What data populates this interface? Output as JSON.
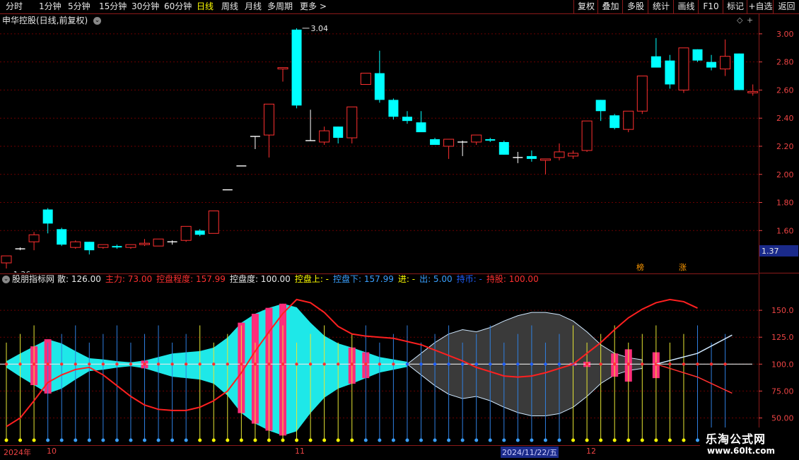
{
  "toolbar": {
    "periods": [
      "分时",
      "1分钟",
      "5分钟",
      "15分钟",
      "30分钟",
      "60分钟",
      "日线",
      "周线",
      "月线",
      "多周期",
      "更多 >"
    ],
    "active_period": "日线",
    "right_buttons": [
      "复权",
      "叠加",
      "多股",
      "统计",
      "画线",
      "F10",
      "标记",
      "+自选",
      "返回"
    ]
  },
  "main": {
    "title": "申华控股(日线,前复权)",
    "high_label": "3.04",
    "low_label": "1.36",
    "price_tag": "1.37",
    "tag_bang": "榜",
    "tag_zhang": "涨",
    "yticks": [
      "3.00",
      "2.80",
      "2.60",
      "2.40",
      "2.20",
      "2.00",
      "1.80",
      "1.60"
    ]
  },
  "indicator": {
    "name": "股朋指标网",
    "items": [
      {
        "label": "散: 126.00",
        "color": "#e8e8e8"
      },
      {
        "label": "主力: 73.00",
        "color": "#ff3030"
      },
      {
        "label": "控盘程度: 157.99",
        "color": "#ff3030"
      },
      {
        "label": "控盘度: 100.00",
        "color": "#e8e8e8"
      },
      {
        "label": "控盘上: -",
        "color": "#ffff00"
      },
      {
        "label": "控盘下: 157.99",
        "color": "#3aa0ff"
      },
      {
        "label": "进: -",
        "color": "#ffff00"
      },
      {
        "label": "出: 5.00",
        "color": "#3aa0ff"
      },
      {
        "label": "持币: -",
        "color": "#2060ff"
      },
      {
        "label": "持股: 100.00",
        "color": "#ff3030"
      }
    ],
    "yticks": [
      "150.0",
      "125.0",
      "100.0",
      "75.00",
      "50.00"
    ]
  },
  "bottom": {
    "labels": [
      "2024年",
      "10",
      "11",
      "2024/11/22/五",
      "12"
    ]
  },
  "watermark": {
    "line1": "乐淘公式网",
    "line2": "www.60lt.com"
  },
  "colors": {
    "up": "#ff3030",
    "down": "#00ffff",
    "grid": "#6b0000",
    "axis": "#8b1a1a"
  },
  "chart_data": {
    "type": "candlestick",
    "candles": [
      {
        "o": 1.37,
        "h": 1.39,
        "l": 1.33,
        "c": 1.42
      },
      {
        "o": 1.47,
        "h": 1.48,
        "l": 1.46,
        "c": 1.47
      },
      {
        "o": 1.52,
        "h": 1.59,
        "l": 1.46,
        "c": 1.57
      },
      {
        "o": 1.75,
        "h": 1.76,
        "l": 1.58,
        "c": 1.65
      },
      {
        "o": 1.61,
        "h": 1.62,
        "l": 1.49,
        "c": 1.5
      },
      {
        "o": 1.48,
        "h": 1.53,
        "l": 1.47,
        "c": 1.52
      },
      {
        "o": 1.52,
        "h": 1.52,
        "l": 1.43,
        "c": 1.46
      },
      {
        "o": 1.48,
        "h": 1.5,
        "l": 1.47,
        "c": 1.5
      },
      {
        "o": 1.49,
        "h": 1.5,
        "l": 1.47,
        "c": 1.48
      },
      {
        "o": 1.48,
        "h": 1.5,
        "l": 1.47,
        "c": 1.5
      },
      {
        "o": 1.5,
        "h": 1.54,
        "l": 1.49,
        "c": 1.51
      },
      {
        "o": 1.49,
        "h": 1.54,
        "l": 1.49,
        "c": 1.54
      },
      {
        "o": 1.52,
        "h": 1.53,
        "l": 1.5,
        "c": 1.52
      },
      {
        "o": 1.53,
        "h": 1.62,
        "l": 1.52,
        "c": 1.63
      },
      {
        "o": 1.6,
        "h": 1.61,
        "l": 1.56,
        "c": 1.57
      },
      {
        "o": 1.58,
        "h": 1.72,
        "l": 1.58,
        "c": 1.74
      },
      {
        "o": 1.89,
        "h": 1.89,
        "l": 1.89,
        "c": 1.89
      },
      {
        "o": 2.06,
        "h": 2.06,
        "l": 2.06,
        "c": 2.06
      },
      {
        "o": 2.27,
        "h": 2.27,
        "l": 2.18,
        "c": 2.27
      },
      {
        "o": 2.28,
        "h": 2.5,
        "l": 2.12,
        "c": 2.5
      },
      {
        "o": 2.75,
        "h": 2.76,
        "l": 2.66,
        "c": 2.76
      },
      {
        "o": 3.03,
        "h": 3.04,
        "l": 2.47,
        "c": 2.49
      },
      {
        "o": 2.24,
        "h": 2.46,
        "l": 2.24,
        "c": 2.24
      },
      {
        "o": 2.23,
        "h": 2.34,
        "l": 2.21,
        "c": 2.31
      },
      {
        "o": 2.34,
        "h": 2.34,
        "l": 2.22,
        "c": 2.26
      },
      {
        "o": 2.26,
        "h": 2.47,
        "l": 2.22,
        "c": 2.48
      },
      {
        "o": 2.64,
        "h": 2.72,
        "l": 2.64,
        "c": 2.72
      },
      {
        "o": 2.72,
        "h": 2.88,
        "l": 2.51,
        "c": 2.53
      },
      {
        "o": 2.53,
        "h": 2.54,
        "l": 2.39,
        "c": 2.41
      },
      {
        "o": 2.41,
        "h": 2.45,
        "l": 2.36,
        "c": 2.38
      },
      {
        "o": 2.37,
        "h": 2.45,
        "l": 2.33,
        "c": 2.3
      },
      {
        "o": 2.25,
        "h": 2.26,
        "l": 2.21,
        "c": 2.21
      },
      {
        "o": 2.2,
        "h": 2.24,
        "l": 2.11,
        "c": 2.25
      },
      {
        "o": 2.23,
        "h": 2.24,
        "l": 2.13,
        "c": 2.23
      },
      {
        "o": 2.23,
        "h": 2.27,
        "l": 2.21,
        "c": 2.28
      },
      {
        "o": 2.25,
        "h": 2.26,
        "l": 2.23,
        "c": 2.24
      },
      {
        "o": 2.23,
        "h": 2.24,
        "l": 2.14,
        "c": 2.14
      },
      {
        "o": 2.12,
        "h": 2.16,
        "l": 2.08,
        "c": 2.12
      },
      {
        "o": 2.13,
        "h": 2.17,
        "l": 2.09,
        "c": 2.11
      },
      {
        "o": 2.1,
        "h": 2.11,
        "l": 2.0,
        "c": 2.11
      },
      {
        "o": 2.12,
        "h": 2.22,
        "l": 2.1,
        "c": 2.16
      },
      {
        "o": 2.13,
        "h": 2.17,
        "l": 2.11,
        "c": 2.15
      },
      {
        "o": 2.17,
        "h": 2.38,
        "l": 2.16,
        "c": 2.38
      },
      {
        "o": 2.53,
        "h": 2.53,
        "l": 2.38,
        "c": 2.45
      },
      {
        "o": 2.42,
        "h": 2.43,
        "l": 2.32,
        "c": 2.33
      },
      {
        "o": 2.32,
        "h": 2.45,
        "l": 2.3,
        "c": 2.45
      },
      {
        "o": 2.45,
        "h": 2.7,
        "l": 2.43,
        "c": 2.7
      },
      {
        "o": 2.84,
        "h": 2.97,
        "l": 2.77,
        "c": 2.76
      },
      {
        "o": 2.81,
        "h": 2.85,
        "l": 2.61,
        "c": 2.64
      },
      {
        "o": 2.6,
        "h": 2.9,
        "l": 2.58,
        "c": 2.9
      },
      {
        "o": 2.89,
        "h": 2.89,
        "l": 2.8,
        "c": 2.81
      },
      {
        "o": 2.8,
        "h": 2.85,
        "l": 2.74,
        "c": 2.76
      },
      {
        "o": 2.75,
        "h": 2.96,
        "l": 2.7,
        "c": 2.84
      },
      {
        "o": 2.86,
        "h": 2.86,
        "l": 2.6,
        "c": 2.6
      },
      {
        "o": 2.58,
        "h": 2.64,
        "l": 2.56,
        "c": 2.59
      }
    ],
    "indicator_series": {
      "kongpan": [
        42,
        50,
        66,
        83,
        90,
        95,
        97,
        90,
        80,
        70,
        62,
        58,
        57,
        57,
        60,
        66,
        75,
        92,
        112,
        130,
        147,
        160,
        157,
        148,
        135,
        128,
        126,
        125,
        124,
        121,
        118,
        113,
        108,
        103,
        97,
        93,
        89,
        88,
        89,
        92,
        96,
        100,
        110,
        120,
        132,
        143,
        151,
        157,
        160,
        158,
        152
      ]
    },
    "ylim_main": [
      1.33,
      3.1
    ],
    "ylim_indicator": [
      30,
      175
    ]
  }
}
